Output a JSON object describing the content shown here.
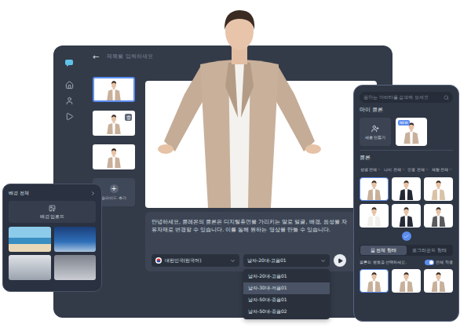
{
  "main_window": {
    "back_icon": "←",
    "title_placeholder": "제목을 입력하세요",
    "slides": [
      {
        "selected": true,
        "deletable": false
      },
      {
        "selected": false,
        "deletable": true
      },
      {
        "selected": false,
        "deletable": false
      }
    ],
    "add_slide": {
      "icon": "+",
      "label": "슬라이드 추가"
    },
    "script": "안녕하세요, 클레온의 클론은 디지털휴먼을 가리키는 말로 얼굴, 배경, 음성을 자유자재로 변경할 수 있습니다. 이를 통해 원하는 영상을 만들 수 있습니다.",
    "language": {
      "value": "대한민국(한국어)"
    },
    "voice": {
      "value": "남자-20대-고음01",
      "expanded": true,
      "options": [
        {
          "label": "남자-20대-고음01",
          "selected": false
        },
        {
          "label": "남자-30대-저음01",
          "selected": true
        },
        {
          "label": "남자-50대-중음01",
          "selected": false
        },
        {
          "label": "남자-50대-중음02",
          "selected": false
        }
      ]
    }
  },
  "background_panel": {
    "title": "배경 전체",
    "upload_label": "배경 업로드",
    "backgrounds": [
      {
        "kind": "beach"
      },
      {
        "kind": "studio"
      },
      {
        "kind": "office"
      },
      {
        "kind": "stage"
      }
    ]
  },
  "clone_panel": {
    "search_placeholder": "원하는 아바타를 검색해 보세요",
    "my_clone_heading": "마이 클론",
    "new_clone_label": "새로 만들기",
    "my_clones": [
      {
        "badge": "NEW",
        "color": "#c8b09a"
      }
    ],
    "clone_heading": "클론",
    "filters": [
      {
        "label": "성별 전체"
      },
      {
        "label": "나이 전체"
      },
      {
        "label": "인종 전체"
      },
      {
        "label": "체형 전체"
      }
    ],
    "clones": [
      {
        "selected": true,
        "color": "#c8b09a"
      },
      {
        "selected": false,
        "color": "#222632"
      },
      {
        "selected": false,
        "color": "#d9c3a8"
      },
      {
        "selected": false,
        "color": "#f2f0ec"
      },
      {
        "selected": false,
        "color": "#262a35"
      },
      {
        "selected": false,
        "color": "#5a5a5e"
      }
    ],
    "tabs": [
      {
        "label": "몸 전체 형태",
        "selected": true
      },
      {
        "label": "포그라운드 형태",
        "selected": false
      }
    ],
    "action_prompt": "클론의 행동을 선택하세요.",
    "apply_all": {
      "label": "전체 적용",
      "on": true
    },
    "actions": [
      {
        "selected": true,
        "color": "#c8b09a"
      },
      {
        "selected": false,
        "color": "#c8b09a"
      },
      {
        "selected": false,
        "color": "#c8b09a"
      }
    ]
  }
}
